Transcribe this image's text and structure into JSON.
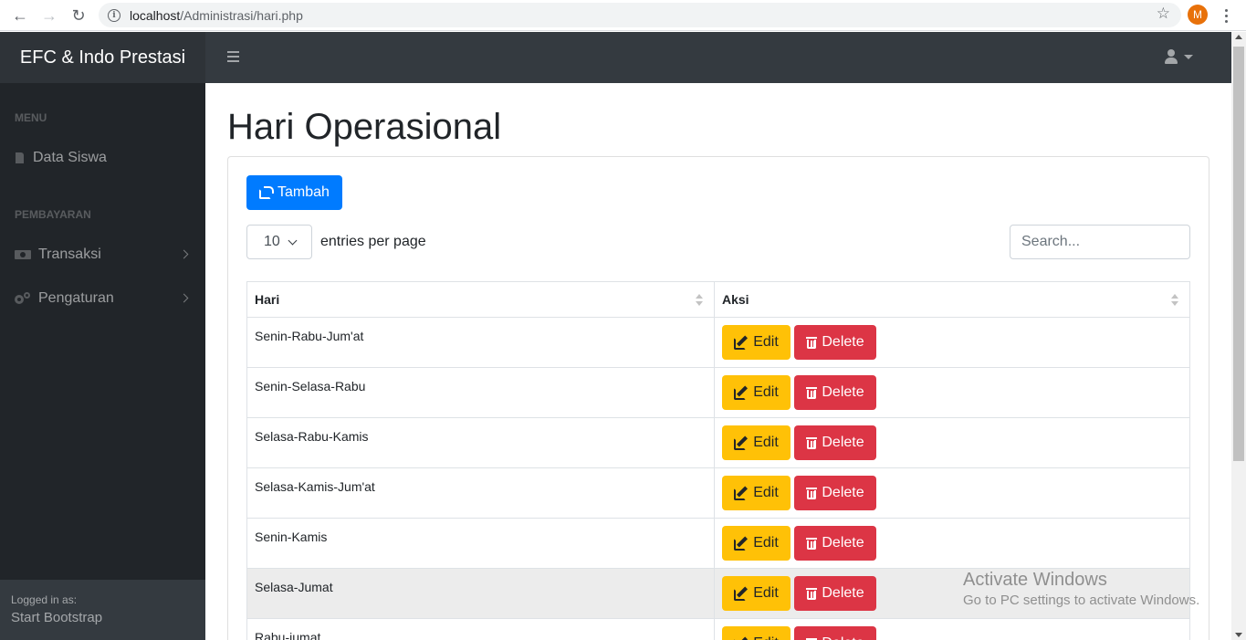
{
  "browser": {
    "url_host": "localhost",
    "url_path": "/Administrasi/hari.php",
    "profile_initial": "M"
  },
  "topnav": {
    "brand": "EFC & Indo Prestasi"
  },
  "sidebar": {
    "heading_menu": "MENU",
    "heading_pembayaran": "PEMBAYARAN",
    "items": [
      {
        "label": "Data Siswa",
        "icon": "file-icon"
      },
      {
        "label": "Transaksi",
        "icon": "money-icon"
      },
      {
        "label": "Pengaturan",
        "icon": "cogs-icon"
      }
    ],
    "footer": {
      "logged_label": "Logged in as:",
      "user": "Start Bootstrap"
    }
  },
  "main": {
    "title": "Hari Operasional",
    "add_button": "Tambah",
    "per_page_value": "10",
    "per_page_label": "entries per page",
    "search_placeholder": "Search...",
    "table": {
      "headers": [
        "Hari",
        "Aksi"
      ],
      "edit_label": "Edit",
      "delete_label": "Delete",
      "rows": [
        "Senin-Rabu-Jum'at",
        "Senin-Selasa-Rabu",
        "Selasa-Rabu-Kamis",
        "Selasa-Kamis-Jum'at",
        "Senin-Kamis",
        "Selasa-Jumat",
        "Rabu-jumat"
      ]
    }
  },
  "watermark": {
    "line1": "Activate Windows",
    "line2": "Go to PC settings to activate Windows."
  }
}
